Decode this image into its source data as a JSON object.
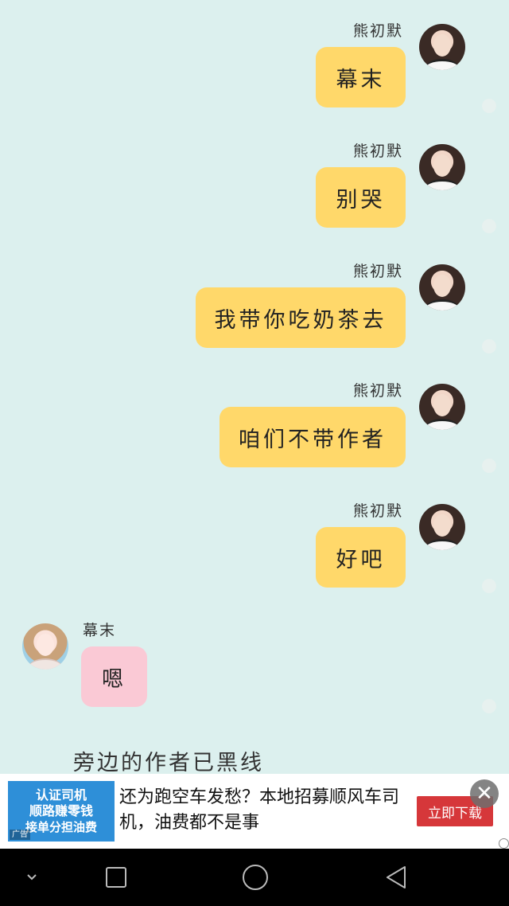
{
  "messages": [
    {
      "sender": "熊初默",
      "text": "幕末",
      "side": "right"
    },
    {
      "sender": "熊初默",
      "text": "别哭",
      "side": "right"
    },
    {
      "sender": "熊初默",
      "text": "我带你吃奶茶去",
      "side": "right"
    },
    {
      "sender": "熊初默",
      "text": "咱们不带作者",
      "side": "right"
    },
    {
      "sender": "熊初默",
      "text": "好吧",
      "side": "right"
    },
    {
      "sender": "幕末",
      "text": "嗯",
      "side": "left"
    }
  ],
  "status_line": "旁边的作者已黑线",
  "ad": {
    "thumb_line1": "认证司机",
    "thumb_line2": "顺路赚零钱",
    "thumb_line3": "接单分担油费",
    "thumb_tag": "广告",
    "headline": "还为跑空车发愁？本地招募顺风车司机，油费都不是事",
    "cta_label": "立即下载"
  },
  "colors": {
    "background": "#dcf0ee",
    "bubble_right": "#ffd86a",
    "bubble_left": "#fac9d5",
    "ad_cta": "#d6373a"
  },
  "icons": [
    "close-icon",
    "chevron-down-icon",
    "square-icon",
    "circle-icon",
    "triangle-back-icon"
  ]
}
